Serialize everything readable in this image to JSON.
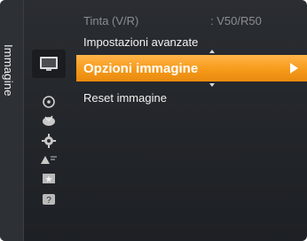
{
  "category": {
    "label": "Immagine"
  },
  "menu": {
    "items": [
      {
        "label": "Tinta (V/R)",
        "value": ": V50/R50",
        "state": "disabled"
      },
      {
        "label": "Impostazioni avanzate",
        "state": "normal"
      },
      {
        "label": "Opzioni immagine",
        "state": "selected"
      },
      {
        "label": "Reset immagine",
        "state": "normal"
      }
    ]
  },
  "icons": [
    {
      "name": "picture-icon",
      "active": true
    },
    {
      "name": "sound-icon",
      "active": false
    },
    {
      "name": "channel-icon",
      "active": false
    },
    {
      "name": "setup-icon",
      "active": false
    },
    {
      "name": "input-icon",
      "active": false
    },
    {
      "name": "application-icon",
      "active": false
    },
    {
      "name": "support-icon",
      "active": false
    }
  ],
  "colors": {
    "highlight": "#f69a1a",
    "background": "#25282c",
    "text": "#f2f2f2",
    "disabled_text": "#8a8d91"
  }
}
